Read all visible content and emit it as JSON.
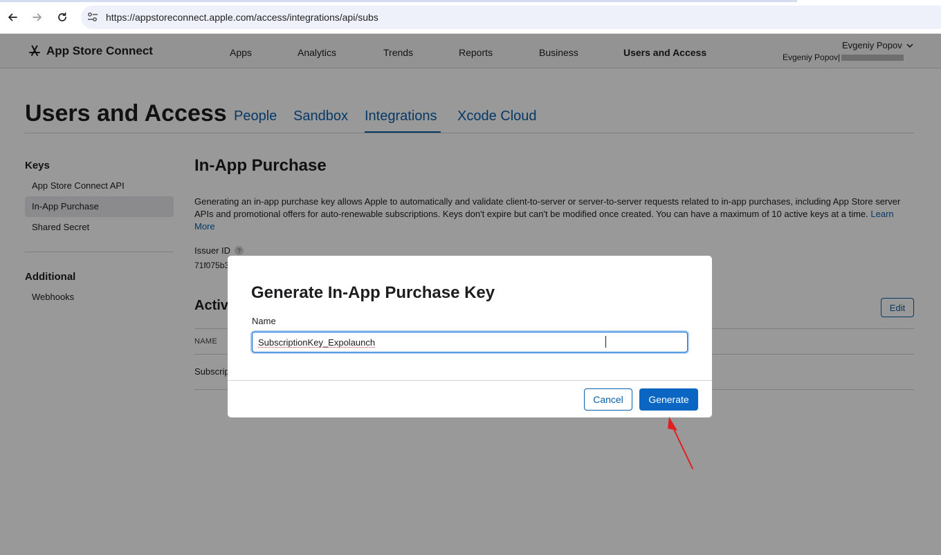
{
  "browser": {
    "url": "https://appstoreconnect.apple.com/access/integrations/api/subs"
  },
  "header": {
    "brand": "App Store Connect",
    "nav": [
      "Apps",
      "Analytics",
      "Trends",
      "Reports",
      "Business",
      "Users and Access"
    ],
    "active_nav": "Users and Access",
    "account_name": "Evgeniy Popov",
    "account_sub": "Evgeniy Popov|"
  },
  "page": {
    "title": "Users and Access",
    "tabs": [
      "People",
      "Sandbox",
      "Integrations",
      "Xcode Cloud"
    ],
    "active_tab": "Integrations"
  },
  "sidebar": {
    "keys_heading": "Keys",
    "keys_items": [
      "App Store Connect API",
      "In-App Purchase",
      "Shared Secret"
    ],
    "selected": "In-App Purchase",
    "additional_heading": "Additional",
    "additional_items": [
      "Webhooks"
    ]
  },
  "main": {
    "section_title": "In-App Purchase",
    "description": "Generating an in-app purchase key allows Apple to automatically and validate client-to-server or server-to-server requests related to in-app purchases, including App Store server APIs and promotional offers for auto-renewable subscriptions. Keys don't expire but can't be modified once created. You can have a maximum of 10 active keys at a time.",
    "learn_more": "Learn More",
    "issuer_label": "Issuer ID",
    "issuer_help": "?",
    "issuer_value": "71f075b3",
    "active_title": "Activ",
    "edit_label": "Edit",
    "column_name": "NAME",
    "row_name": "Subscrip"
  },
  "modal": {
    "title": "Generate In-App Purchase Key",
    "field_label": "Name",
    "field_value": "SubscriptionKey_Expolaunch",
    "cancel_label": "Cancel",
    "generate_label": "Generate"
  },
  "colors": {
    "accent": "#0a5fa8",
    "primary_button": "#0a66c2",
    "annotation_arrow": "#e02020"
  }
}
